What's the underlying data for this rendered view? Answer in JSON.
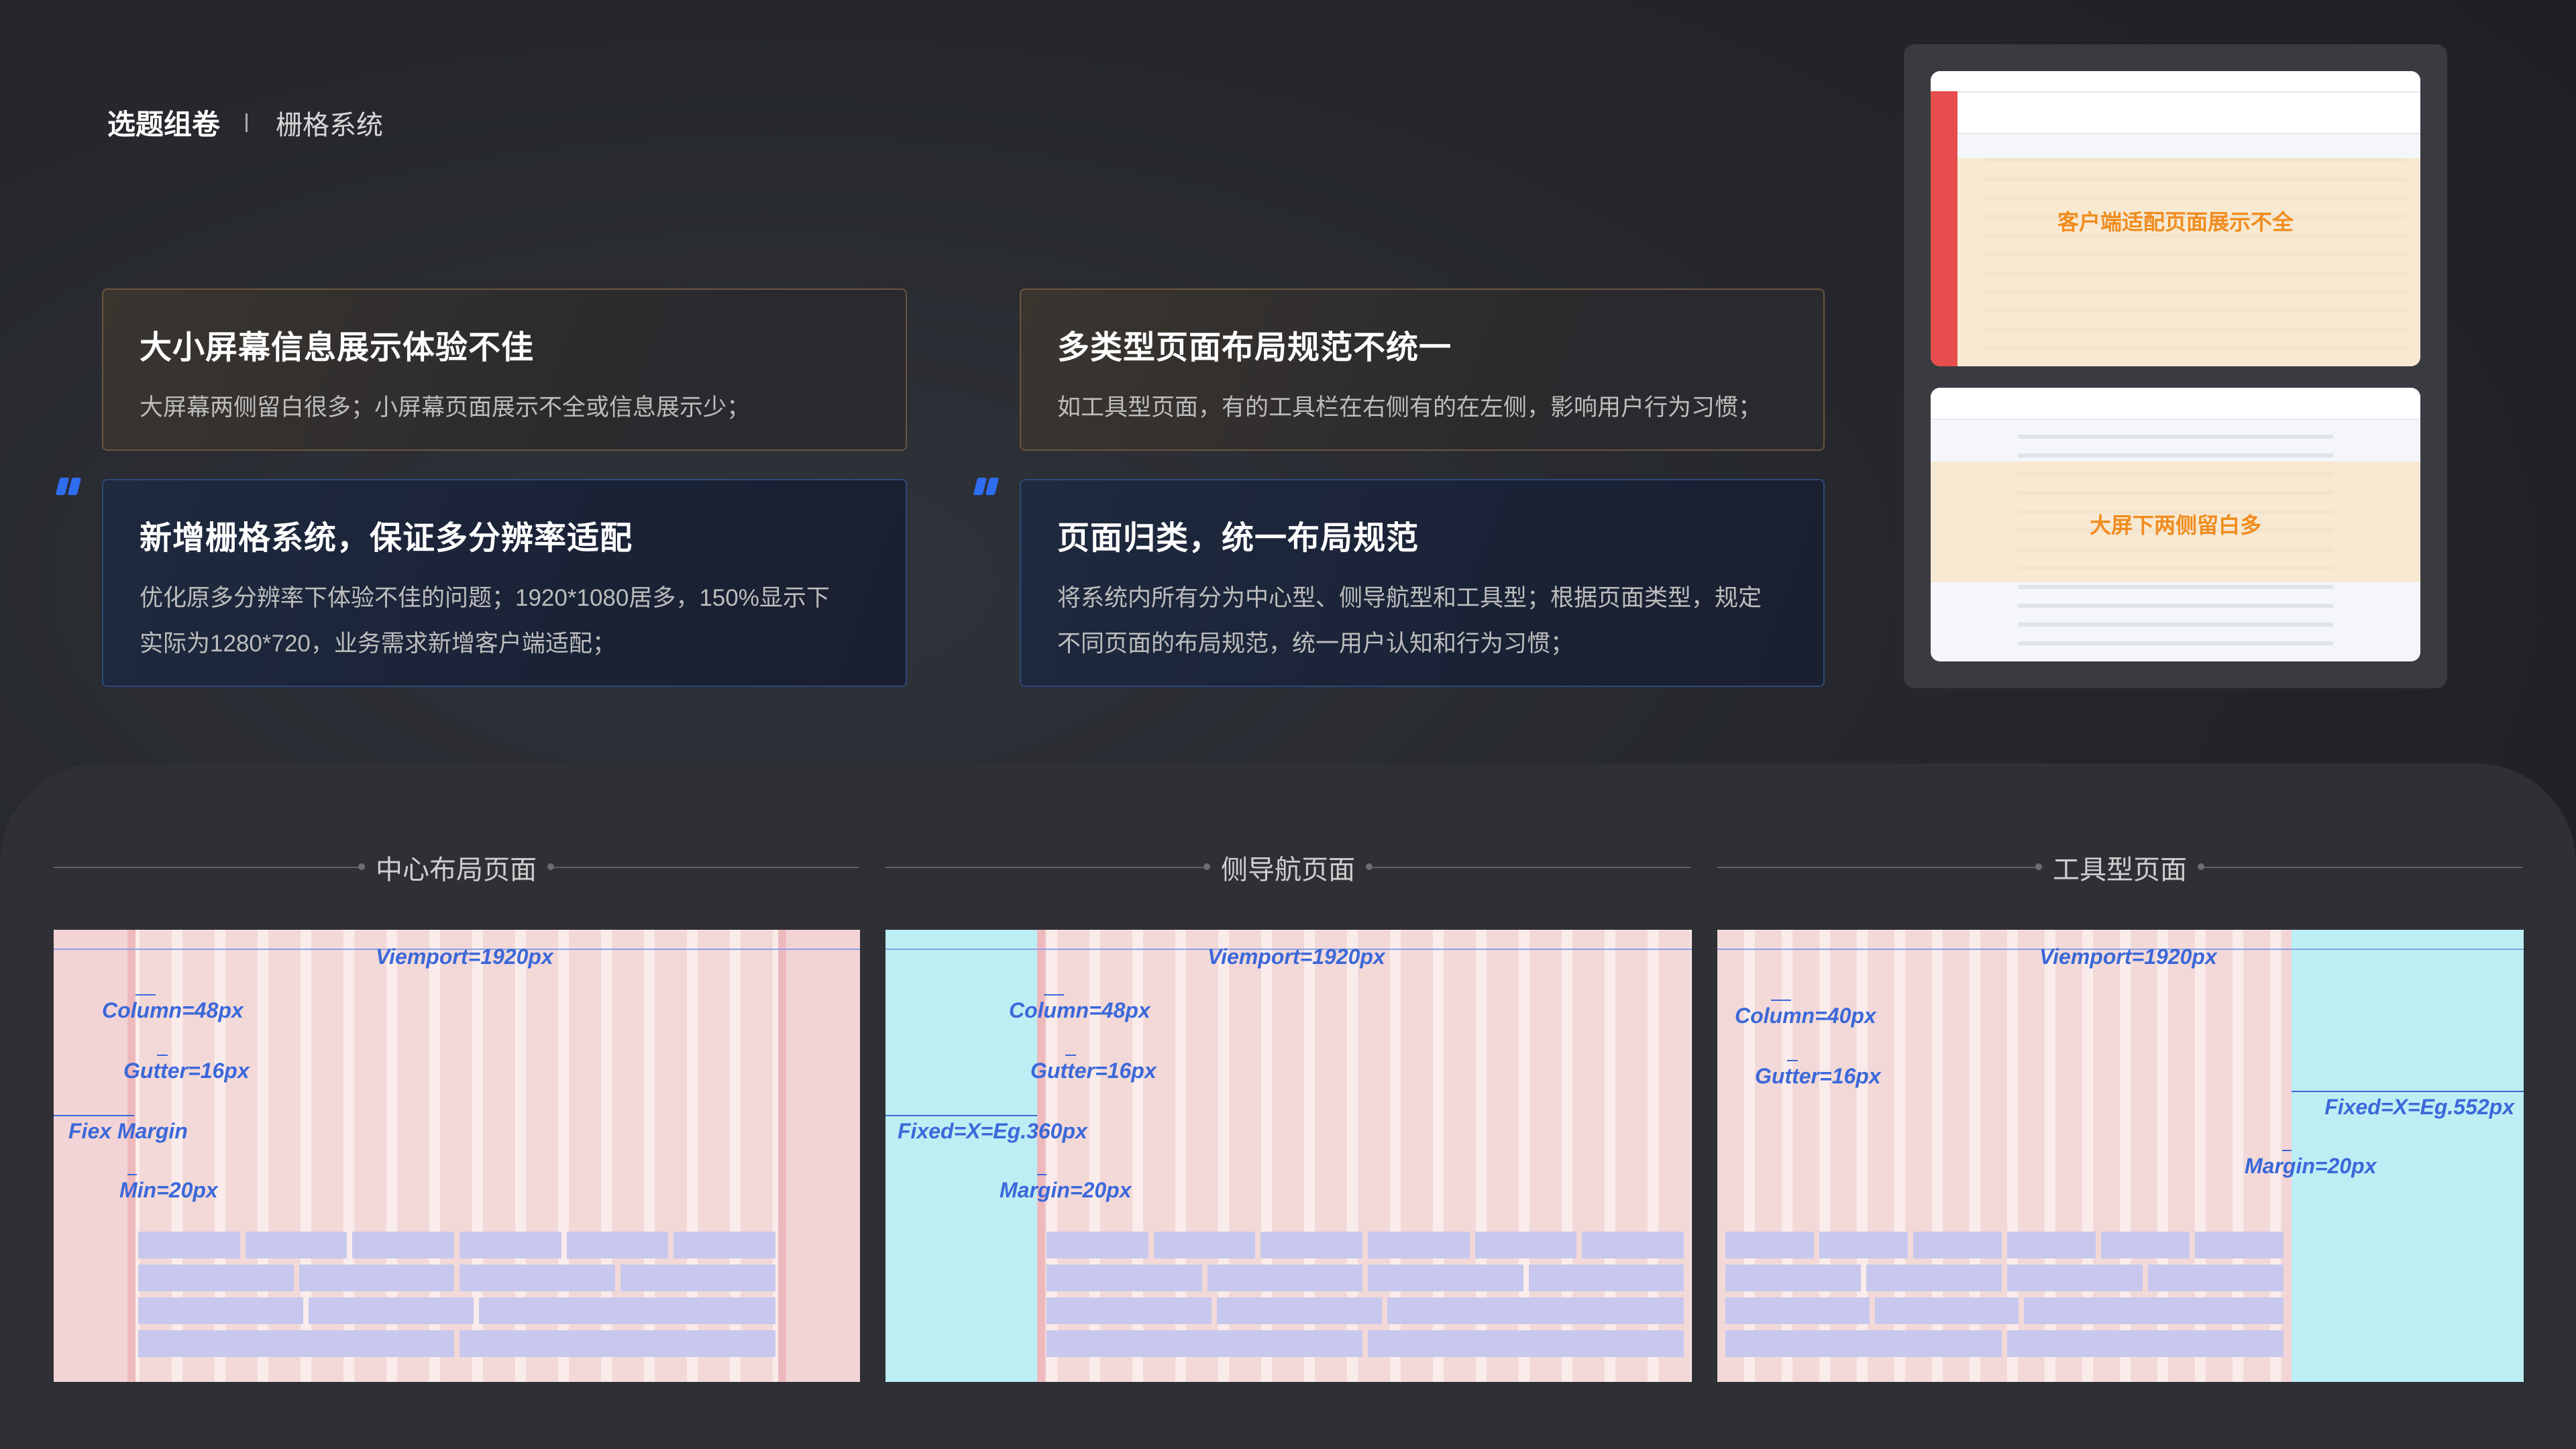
{
  "header": {
    "title": "选题组卷",
    "subtitle": "栅格系统"
  },
  "problems": [
    {
      "title": "大小屏幕信息展示体验不佳",
      "desc": "大屏幕两侧留白很多；小屏幕页面展示不全或信息展示少；"
    },
    {
      "title": "多类型页面布局规范不统一",
      "desc": "如工具型页面，有的工具栏在右侧有的在左侧，影响用户行为习惯；"
    }
  ],
  "solutions": [
    {
      "title": "新增栅格系统，保证多分辨率适配",
      "line1": "优化原多分辨率下体验不佳的问题；1920*1080居多，150%显示下",
      "line2": "实际为1280*720，业务需求新增客户端适配；"
    },
    {
      "title": "页面归类，统一布局规范",
      "line1": "将系统内所有分为中心型、侧导航型和工具型；根据页面类型，规定",
      "line2": "不同页面的布局规范，统一用户认知和行为习惯；"
    }
  ],
  "screenshots": {
    "top_caption": "客户端适配页面展示不全",
    "bottom_caption": "大屏下两侧留白多"
  },
  "sections": [
    {
      "label": "中心布局页面",
      "viewport": "Viemport=1920px",
      "column": "Column=48px",
      "gutter": "Gutter=16px",
      "margin_label": "Fiex Margin",
      "min": "Min=20px"
    },
    {
      "label": "侧导航页面",
      "viewport": "Viemport=1920px",
      "column": "Column=48px",
      "gutter": "Gutter=16px",
      "fixed": "Fixed=X=Eg.360px",
      "margin": "Margin=20px"
    },
    {
      "label": "工具型页面",
      "viewport": "Viemport=1920px",
      "column": "Column=40px",
      "gutter": "Gutter=16px",
      "fixed": "Fixed=X=Eg.552px",
      "margin": "Margin=20px"
    }
  ],
  "colors": {
    "problem_border": "#6b5540",
    "solution_border": "#2c4a7a",
    "quote_accent": "#2e6cf0",
    "margin_pink": "#f3d4d6",
    "fixed_cyan": "#bdeef3",
    "annotation_blue": "#3b68d9",
    "content_block": "#c8c8ee",
    "caption_orange": "#f08c1e"
  }
}
